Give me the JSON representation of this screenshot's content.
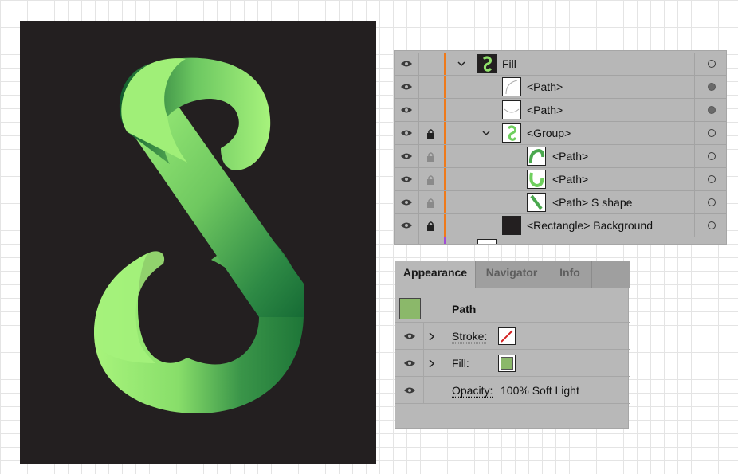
{
  "artboard": {
    "background_color": "#231f20",
    "logo": "S-shape-green-gradient",
    "gradient_light": "#a6f57a",
    "gradient_dark": "#0f5a2c"
  },
  "layers": {
    "accent_orange": "#ef7a1a",
    "accent_purple": "#a24bd6",
    "rows": [
      {
        "name": "Fill",
        "indent": 0,
        "expanded": true,
        "locked": false,
        "target": "empty"
      },
      {
        "name": "<Path>",
        "indent": 1,
        "locked": false,
        "target": "filled"
      },
      {
        "name": "<Path>",
        "indent": 1,
        "locked": false,
        "target": "filled"
      },
      {
        "name": "<Group>",
        "indent": 1,
        "expanded": true,
        "locked": true,
        "target": "empty"
      },
      {
        "name": "<Path>",
        "indent": 2,
        "locked": "dim",
        "target": "empty"
      },
      {
        "name": "<Path>",
        "indent": 2,
        "locked": "dim",
        "target": "empty"
      },
      {
        "name": "<Path> S shape",
        "indent": 2,
        "locked": "dim",
        "target": "empty"
      },
      {
        "name": "<Rectangle> Background",
        "indent": 1,
        "locked": true,
        "target": "empty"
      }
    ]
  },
  "appearance": {
    "tabs": [
      "Appearance",
      "Navigator",
      "Info"
    ],
    "active_tab": "Appearance",
    "object_type": "Path",
    "object_swatch_color": "#8bb86a",
    "stroke_label": "Stroke:",
    "fill_label": "Fill:",
    "fill_color": "#8bb86a",
    "opacity_label": "Opacity:",
    "opacity_value": "100% Soft Light"
  }
}
